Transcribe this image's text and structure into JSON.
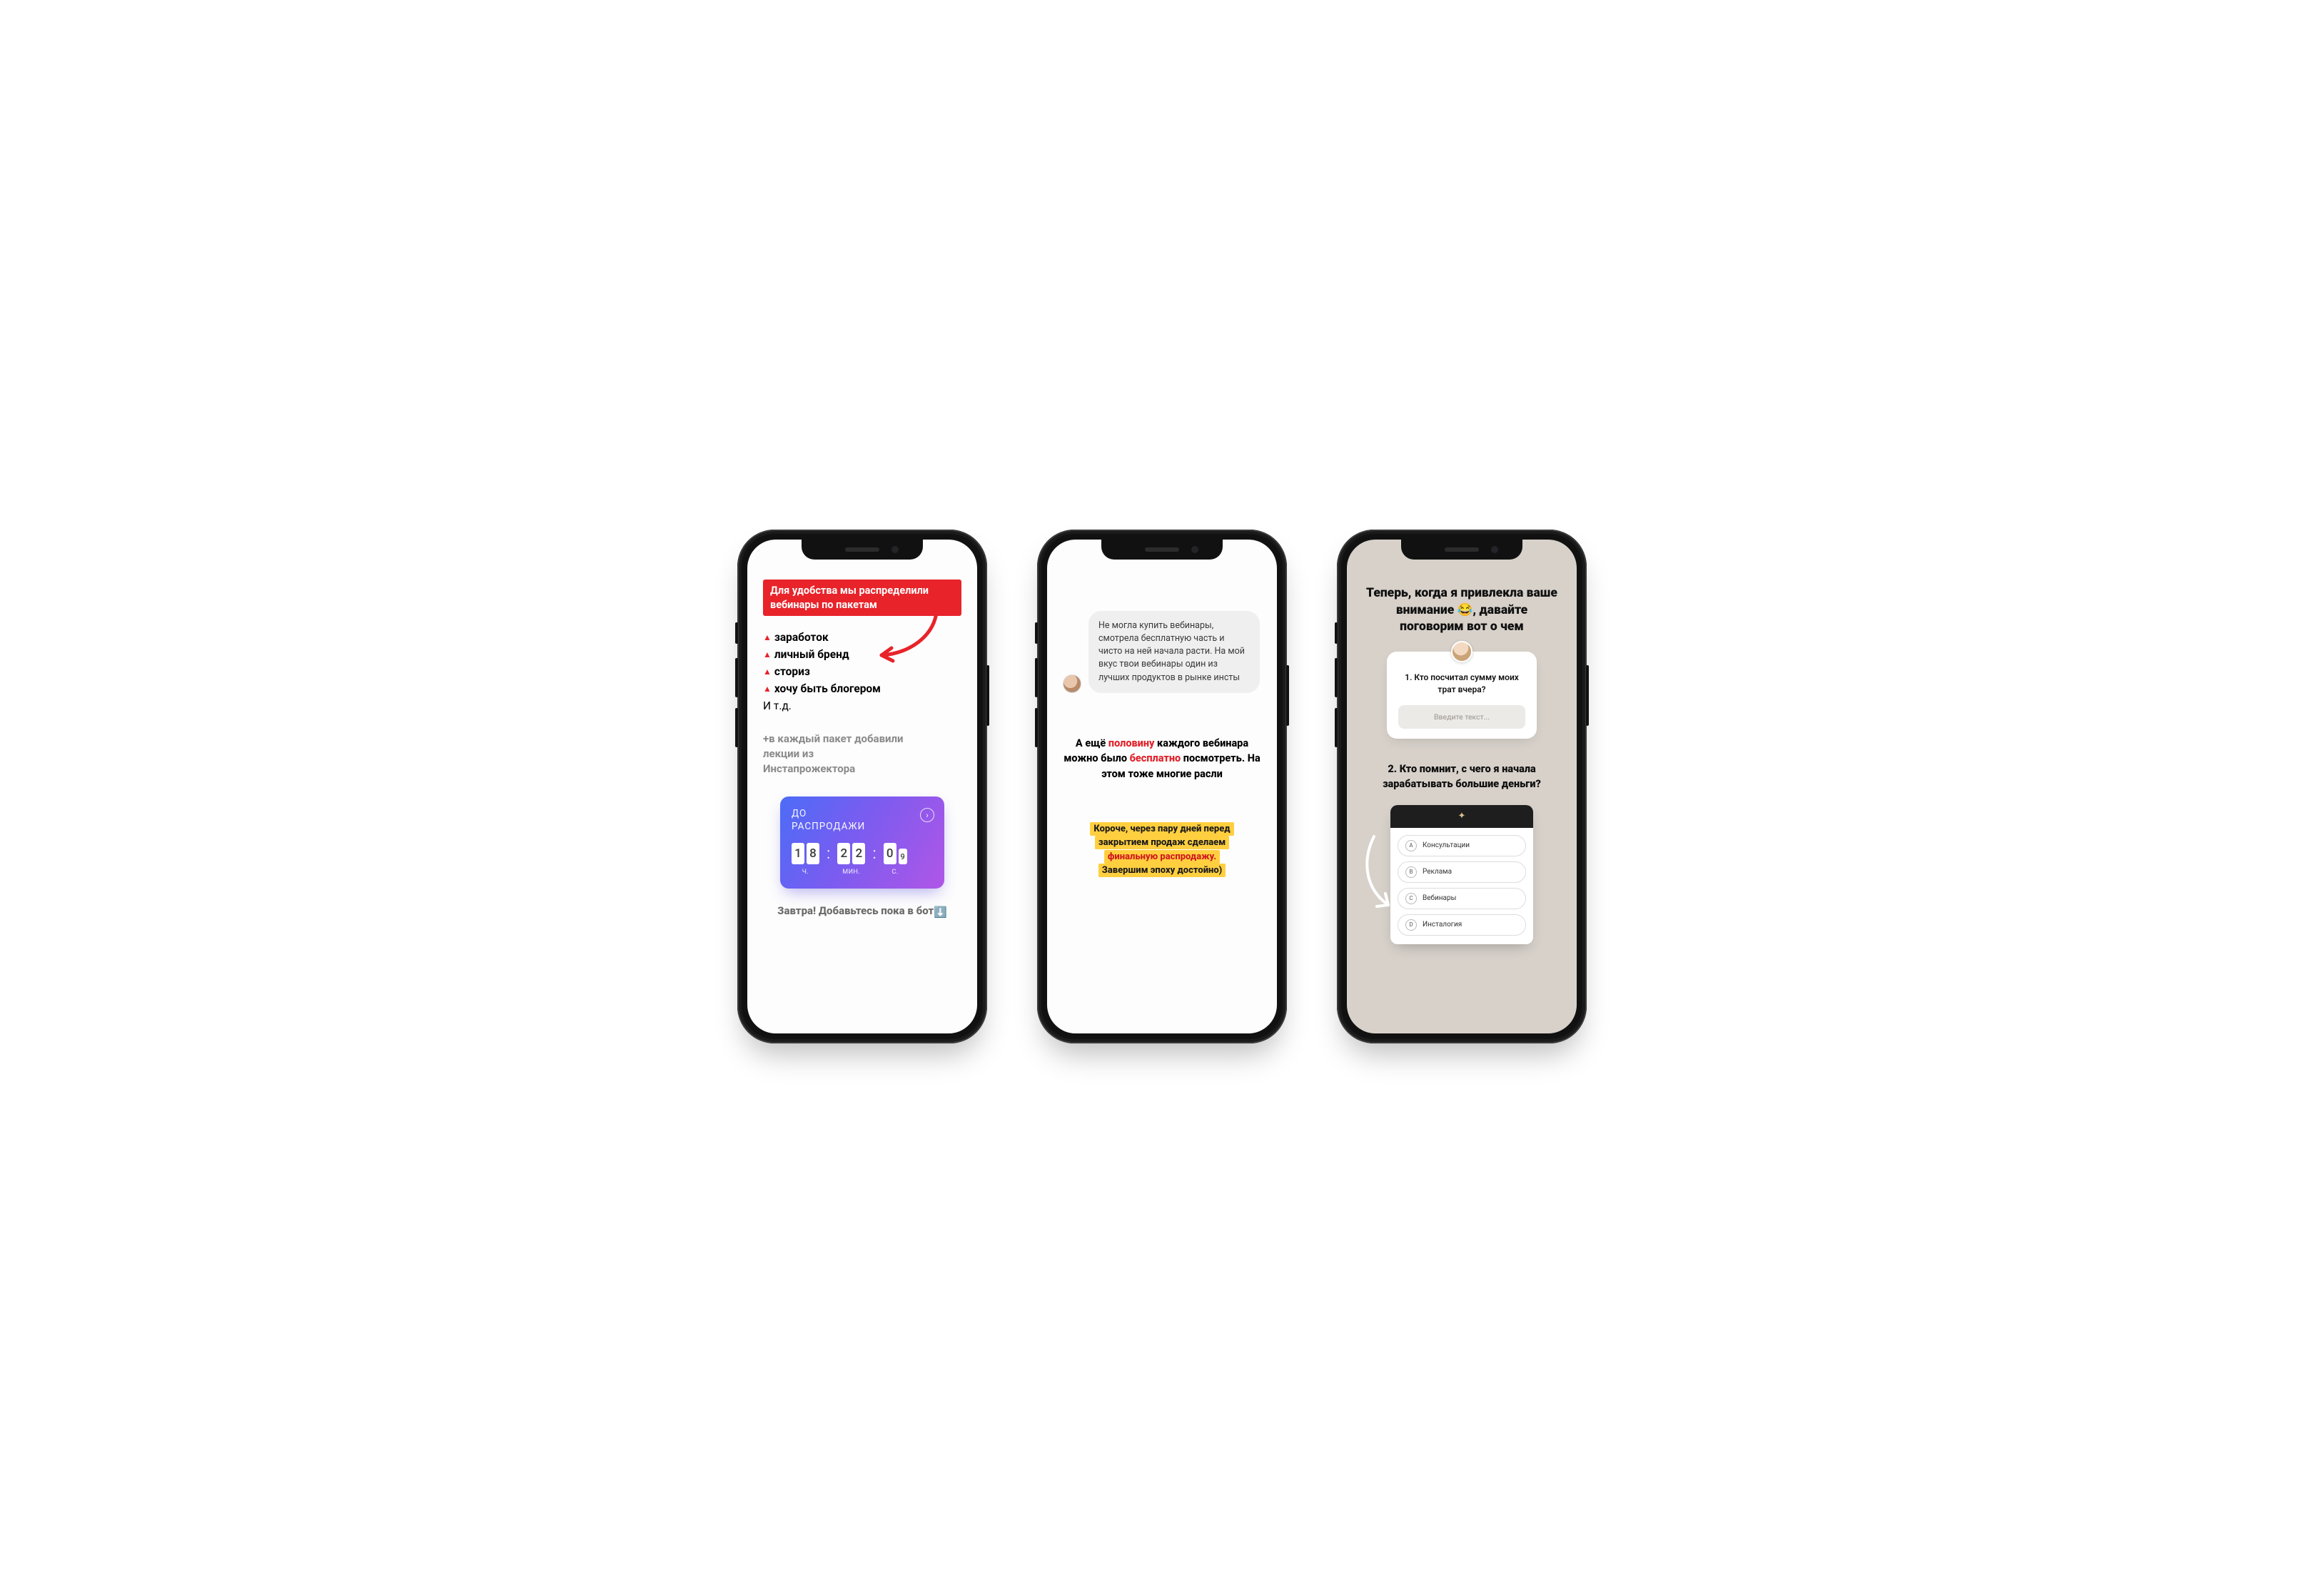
{
  "phone1": {
    "banner": "Для удобства мы распределили вебинары по пакетам",
    "items": [
      "заработок",
      "личный бренд",
      "сториз",
      "хочу быть блогером"
    ],
    "etc": "И т.д.",
    "reminder": "+в каждый пакет добавили лекции из Инстапрожектора",
    "timer": {
      "label_line1": "ДО",
      "label_line2": "РАСПРОДАЖИ",
      "hours": [
        "1",
        "8"
      ],
      "minutes": [
        "2",
        "2"
      ],
      "seconds": [
        "0",
        "9"
      ],
      "unit_h": "Ч.",
      "unit_m": "МИН.",
      "unit_s": "С."
    },
    "cta": "Завтра! Добавьтесь пока в бот",
    "cta_emoji": "⬇️"
  },
  "phone2": {
    "message": "Не могла купить вебинары, смотрела бесплатную часть и чисто на ней начала расти.  На мой вкус твои вебинары один из лучших продуктов в рынке инсты",
    "mid": {
      "pre": "А ещё ",
      "hl1": "половину",
      "mid1": " каждого вебинара можно было ",
      "hl2": "бесплатно",
      "post": " посмотреть. На этом тоже многие расли"
    },
    "callout": {
      "l1": "Короче, через пару дней перед",
      "l2": "закрытием продаж сделаем",
      "l3": "финальную распродажу.",
      "l4": "Завершим эпоху достойно)"
    }
  },
  "phone3": {
    "title_pre": "Теперь, когда я привлекла ваше внимание ",
    "title_emoji": "😂",
    "title_post": ", давайте поговорим вот о чем",
    "question1": "1. Кто посчитал сумму моих трат вчера?",
    "input_placeholder": "Введите текст...",
    "question2": "2. Кто помнит, с чего я начала зарабатывать большие деньги?",
    "quiz_icon": "✦",
    "options": [
      {
        "letter": "A",
        "label": "Консультации"
      },
      {
        "letter": "B",
        "label": "Реклама"
      },
      {
        "letter": "C",
        "label": "Вебинары"
      },
      {
        "letter": "D",
        "label": "Инсталогия"
      }
    ]
  }
}
